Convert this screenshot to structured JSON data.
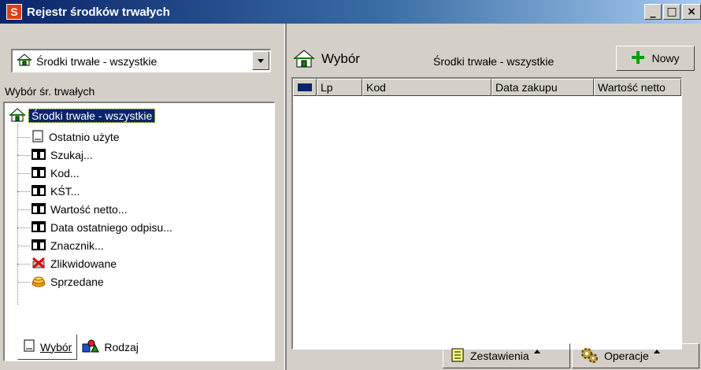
{
  "window": {
    "app_icon_letter": "S",
    "title": "Rejestr środków trwałych",
    "controls": {
      "minimize": "_",
      "maximize": "□",
      "close": "×"
    }
  },
  "left_panel": {
    "combo_value": "Środki trwałe - wszystkie",
    "tree_label": "Wybór śr. trwałych",
    "tree": {
      "root": "Środki trwałe - wszystkie",
      "items": [
        {
          "label": "Ostatnio użyte",
          "icon": "document-icon"
        },
        {
          "label": "Szukaj...",
          "icon": "binoculars-icon"
        },
        {
          "label": "Kod...",
          "icon": "binoculars-icon"
        },
        {
          "label": "KŚT...",
          "icon": "binoculars-icon"
        },
        {
          "label": "Wartość netto...",
          "icon": "binoculars-icon"
        },
        {
          "label": "Data ostatniego odpisu...",
          "icon": "binoculars-icon"
        },
        {
          "label": "Znacznik...",
          "icon": "binoculars-icon"
        },
        {
          "label": "Zlikwidowane",
          "icon": "red-x-icon"
        },
        {
          "label": "Sprzedane",
          "icon": "coins-icon"
        }
      ]
    },
    "tabs": [
      {
        "label": "Wybór",
        "active": true
      },
      {
        "label": "Rodzaj",
        "active": false
      }
    ]
  },
  "right_panel": {
    "wybor_label": "Wybór",
    "filter_title": "Środki trwałe - wszystkie",
    "new_button": "Nowy",
    "columns": [
      "Lp",
      "Kod",
      "Data zakupu",
      "Wartość netto"
    ],
    "footer_buttons": [
      "Zestawienia",
      "Operacje"
    ]
  },
  "colors": {
    "title_bar_start": "#0a246a",
    "window_bg": "#d4d0c8",
    "selection": "#0a246a"
  }
}
